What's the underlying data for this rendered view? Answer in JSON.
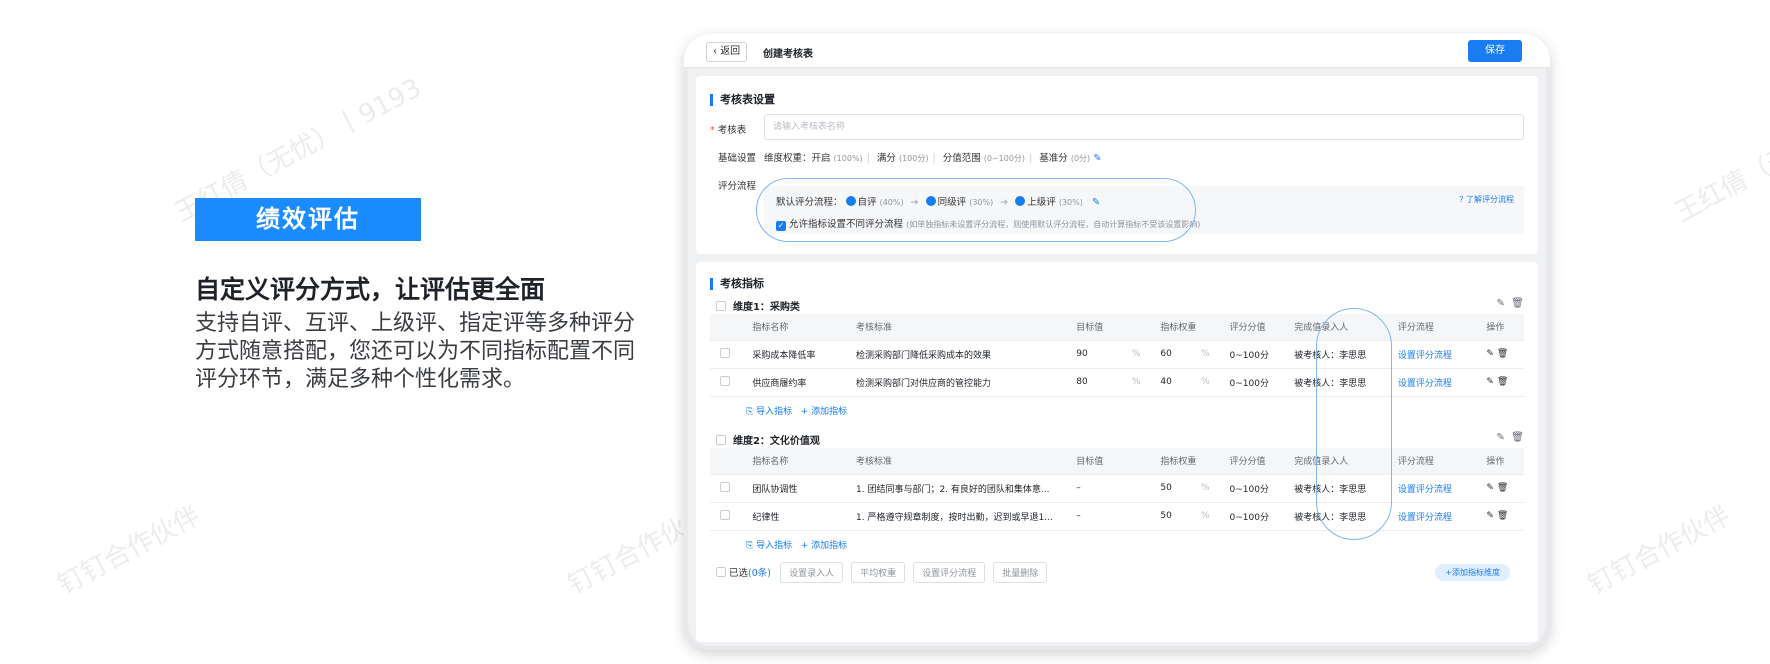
{
  "watermarks": {
    "name": "王红倩（无忧）丨9193",
    "partner": "钉钉合作伙伴"
  },
  "promo": {
    "badge": "绩效评估",
    "headline": "自定义评分方式，让评估更全面",
    "description": "支持自评、互评、上级评、指定评等多种评分方式随意搭配，您还可以为不同指标配置不同评分环节，满足多种个性化需求。"
  },
  "app": {
    "back_label": "返回",
    "page_title": "创建考核表",
    "save_label": "保存",
    "setup": {
      "section_title": "考核表设置",
      "name_label": "考核表",
      "name_placeholder": "请输入考核表名称",
      "basic_label": "基础设置",
      "weight_label": "维度权重：开启",
      "weight_hint": "(100%)",
      "full_label": "满分",
      "full_hint": "(100分)",
      "range_label": "分值范围",
      "range_hint": "(0~100分)",
      "base_label": "基准分",
      "base_hint": "(0分)",
      "flow_label": "评分流程",
      "default_flow_label": "默认评分流程：",
      "flow_steps": [
        {
          "label": "自评",
          "weight": "(40%)"
        },
        {
          "label": "同级评",
          "weight": "(30%)"
        },
        {
          "label": "上级评",
          "weight": "(30%)"
        }
      ],
      "learn_link": "了解评分流程",
      "allow_label": "允许指标设置不同评分流程",
      "allow_hint": "(如单独指标未设置评分流程，则使用默认评分流程，自动计算指标不受该设置影响)"
    },
    "metrics": {
      "section_title": "考核指标",
      "columns": [
        "指标名称",
        "考核标准",
        "目标值",
        "指标权重",
        "评分分值",
        "完成值录入人",
        "评分流程",
        "操作"
      ],
      "dims": [
        {
          "title": "维度1：采购类",
          "rows": [
            {
              "name": "采购成本降低率",
              "std": "检测采购部门降低采购成本的效果",
              "target": "90",
              "target_unit": "%",
              "weight": "60",
              "weight_unit": "%",
              "score": "0~100分",
              "entry": "被考核人：李思思",
              "flow": "设置评分流程"
            },
            {
              "name": "供应商履约率",
              "std": "检测采购部门对供应商的管控能力",
              "target": "80",
              "target_unit": "%",
              "weight": "40",
              "weight_unit": "%",
              "score": "0~100分",
              "entry": "被考核人：李思思",
              "flow": "设置评分流程"
            }
          ]
        },
        {
          "title": "维度2：文化价值观",
          "rows": [
            {
              "name": "团队协调性",
              "std": "1. 团结同事与部门；2. 有良好的团队和集体意...",
              "target": "–",
              "target_unit": "",
              "weight": "50",
              "weight_unit": "%",
              "score": "0~100分",
              "entry": "被考核人：李思思",
              "flow": "设置评分流程"
            },
            {
              "name": "纪律性",
              "std": "1. 严格遵守规章制度，按时出勤，迟到或早退1...",
              "target": "–",
              "target_unit": "",
              "weight": "50",
              "weight_unit": "%",
              "score": "0~100分",
              "entry": "被考核人：李思思",
              "flow": "设置评分流程"
            }
          ]
        }
      ],
      "import_label": "导入指标",
      "add_label": "+ 添加指标",
      "selected_label": "已选",
      "selected_count": "(0条)",
      "bulk": [
        "设置录入人",
        "平均权重",
        "设置评分流程",
        "批量删除"
      ],
      "add_dim_label": "+添加指标维度"
    }
  }
}
